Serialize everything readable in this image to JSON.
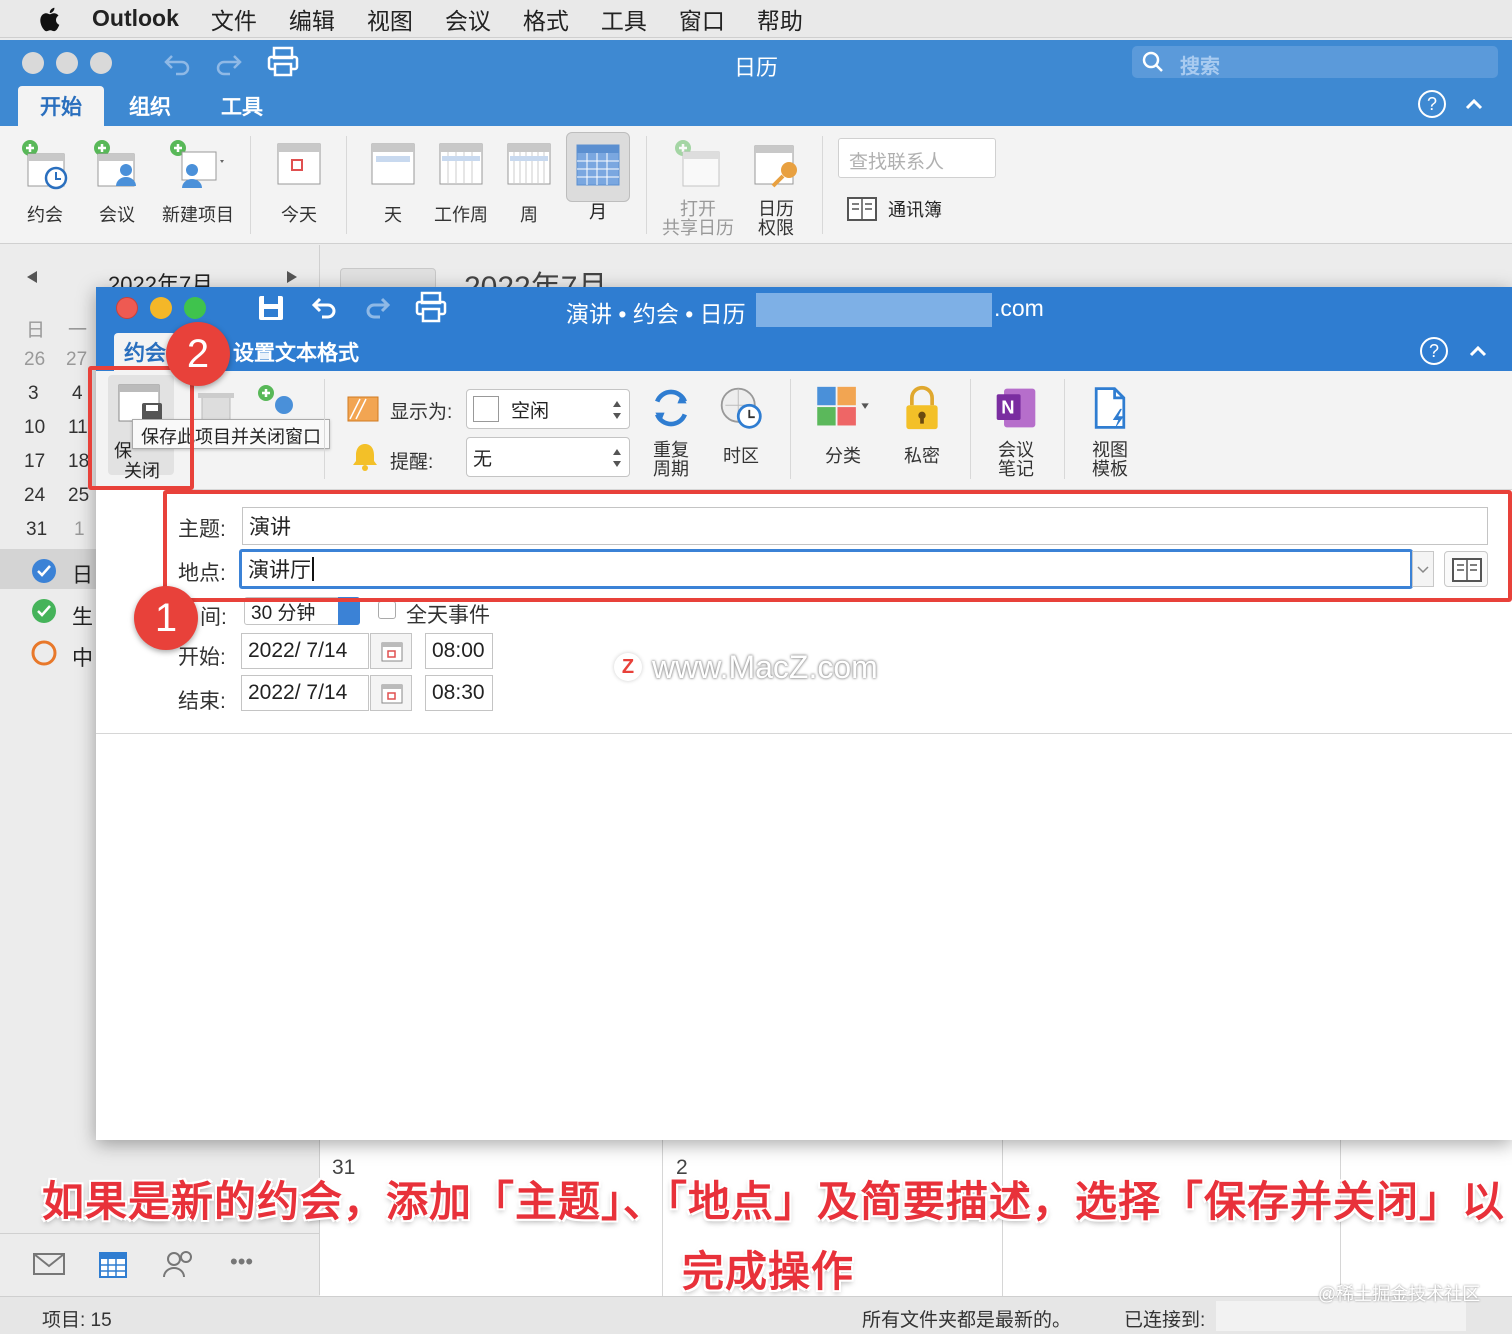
{
  "menubar": {
    "app": "Outlook",
    "items": [
      "文件",
      "编辑",
      "视图",
      "会议",
      "格式",
      "工具",
      "窗口",
      "帮助"
    ]
  },
  "main": {
    "title": "日历",
    "search_placeholder": "搜索",
    "tabs": [
      "开始",
      "组织",
      "工具"
    ],
    "ribbon": {
      "appointment": "约会",
      "meeting": "会议",
      "new_item": "新建项目",
      "today": "今天",
      "day": "天",
      "work_week": "工作周",
      "week": "周",
      "month": "月",
      "open_shared_1": "打开",
      "open_shared_2": "共享日历",
      "permissions_1": "日历",
      "permissions_2": "权限",
      "find_contact_placeholder": "查找联系人",
      "address_book": "通讯簿"
    },
    "month_title": "2022年7月",
    "month_title_right": "2022年7月"
  },
  "sidebar": {
    "weekday_header": [
      "日",
      "一"
    ],
    "weeks": [
      [
        "26",
        "27"
      ],
      [
        "3",
        "4"
      ],
      [
        "10",
        "11"
      ],
      [
        "17",
        "18"
      ],
      [
        "24",
        "25"
      ],
      [
        "31",
        "1"
      ]
    ],
    "calendars": [
      "日历",
      "生日",
      "中国节假日"
    ],
    "cal_items": [
      "日",
      "生",
      "中"
    ]
  },
  "appt": {
    "title": "演讲 • 约会 • 日历",
    "title_suffix": ".com",
    "tabs": [
      "约会",
      "设置文本格式"
    ],
    "ribbon": {
      "save_close_1": "保",
      "save_close_2": "关闭",
      "tooltip": "保存此项目并关闭窗口",
      "show_as_label": "显示为:",
      "show_as_value": "空闲",
      "reminder_label": "提醒:",
      "reminder_value": "无",
      "recurrence_1": "重复",
      "recurrence_2": "周期",
      "timezone": "时区",
      "categorize": "分类",
      "private": "私密",
      "meeting_notes_1": "会议",
      "meeting_notes_2": "笔记",
      "view_templates_1": "视图",
      "view_templates_2": "模板"
    },
    "subject_label": "主题:",
    "subject_value": "演讲",
    "location_label": "地点:",
    "location_value": "演讲厅",
    "duration_label": "间:",
    "duration_value": "30 分钟",
    "allday_label": "全天事件",
    "start_label": "开始:",
    "start_date": "2022/ 7/14",
    "start_time": "08:00",
    "end_label": "结束:",
    "end_date": "2022/ 7/14",
    "end_time": "08:30"
  },
  "watermark": "www.MacZ.com",
  "badges": [
    "1",
    "2"
  ],
  "caption_line1": "如果是新的约会，添加「主题」、「地点」及简要描述，选择「保存并关闭」以",
  "caption_line2": "完成操作",
  "calendar_cells": [
    "31",
    "2"
  ],
  "statusbar": {
    "items": "项目: 15",
    "uptodate": "所有文件夹都是最新的。",
    "connected": "已连接到:"
  },
  "credit": "@稀土掘金技术社区",
  "colors": {
    "title_blue": "#3e89d2",
    "accent_red": "#e8413a",
    "focus_blue": "#3b82d6"
  }
}
